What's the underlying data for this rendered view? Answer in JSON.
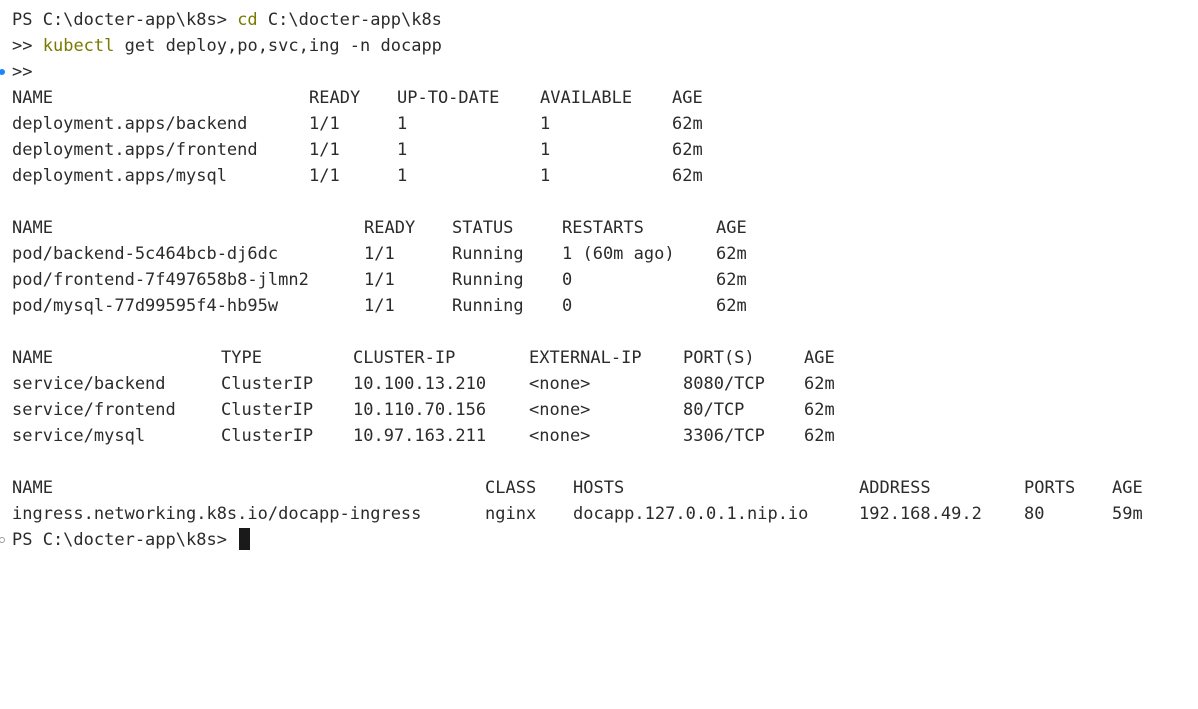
{
  "prompt": "PS C:\\docter-app\\k8s>",
  "command1": {
    "cmd": "cd",
    "args": "C:\\docter-app\\k8s"
  },
  "command2": {
    "prefix": ">>",
    "cmd": "kubectl",
    "args": "get deploy,po,svc,ing -n docapp"
  },
  "continuation": ">>",
  "deployments": {
    "headers": [
      "NAME",
      "READY",
      "UP-TO-DATE",
      "AVAILABLE",
      "AGE"
    ],
    "rows": [
      [
        "deployment.apps/backend",
        "1/1",
        "1",
        "1",
        "62m"
      ],
      [
        "deployment.apps/frontend",
        "1/1",
        "1",
        "1",
        "62m"
      ],
      [
        "deployment.apps/mysql",
        "1/1",
        "1",
        "1",
        "62m"
      ]
    ]
  },
  "pods": {
    "headers": [
      "NAME",
      "READY",
      "STATUS",
      "RESTARTS",
      "AGE"
    ],
    "rows": [
      [
        "pod/backend-5c464bcb-dj6dc",
        "1/1",
        "Running",
        "1 (60m ago)",
        "62m"
      ],
      [
        "pod/frontend-7f497658b8-jlmn2",
        "1/1",
        "Running",
        "0",
        "62m"
      ],
      [
        "pod/mysql-77d99595f4-hb95w",
        "1/1",
        "Running",
        "0",
        "62m"
      ]
    ]
  },
  "services": {
    "headers": [
      "NAME",
      "TYPE",
      "CLUSTER-IP",
      "EXTERNAL-IP",
      "PORT(S)",
      "AGE"
    ],
    "rows": [
      [
        "service/backend",
        "ClusterIP",
        "10.100.13.210",
        "<none>",
        "8080/TCP",
        "62m"
      ],
      [
        "service/frontend",
        "ClusterIP",
        "10.110.70.156",
        "<none>",
        "80/TCP",
        "62m"
      ],
      [
        "service/mysql",
        "ClusterIP",
        "10.97.163.211",
        "<none>",
        "3306/TCP",
        "62m"
      ]
    ]
  },
  "ingress": {
    "headers": [
      "NAME",
      "CLASS",
      "HOSTS",
      "ADDRESS",
      "PORTS",
      "AGE"
    ],
    "rows": [
      [
        "ingress.networking.k8s.io/docapp-ingress",
        "nginx",
        "docapp.127.0.0.1.nip.io",
        "192.168.49.2",
        "80",
        "59m"
      ]
    ]
  },
  "final_prompt": "PS C:\\docter-app\\k8s>",
  "colors": {
    "command": "#7a7a00",
    "text": "#2b2b2b",
    "gutter_active": "#1a85ff",
    "gutter_idle": "#9a9a9a"
  },
  "icons": [
    "command-decoration-success-icon",
    "command-decoration-idle-icon"
  ]
}
